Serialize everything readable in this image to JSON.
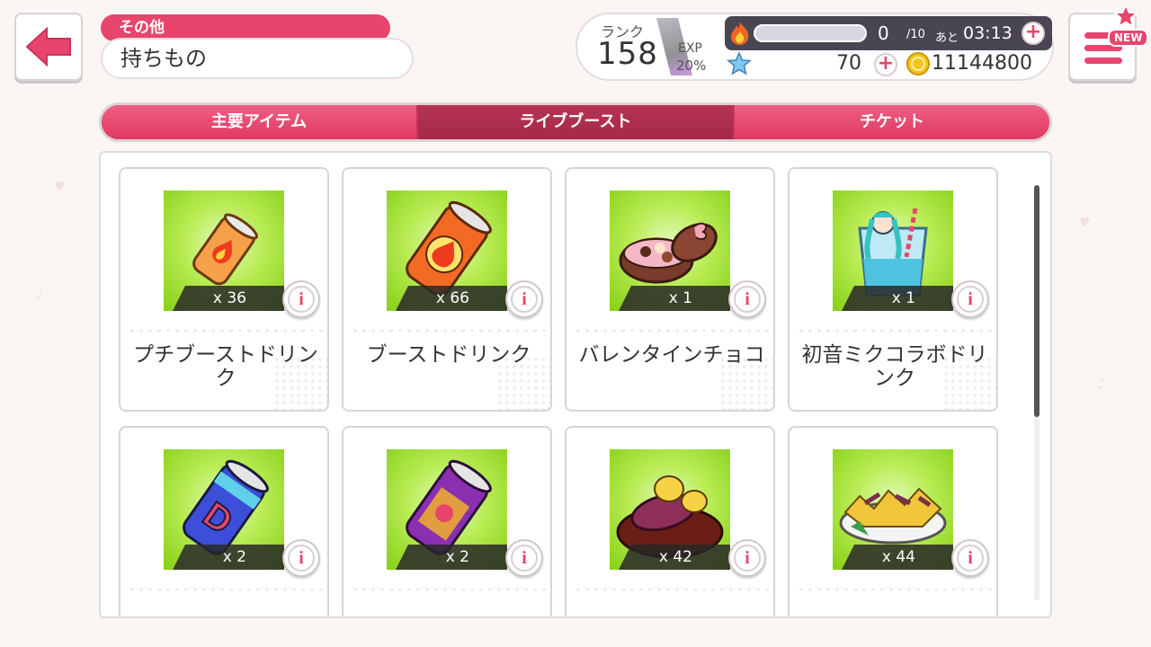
{
  "header": {
    "breadcrumb": "その他",
    "title": "持ちもの"
  },
  "player": {
    "rank_label": "ランク",
    "rank": "158",
    "exp_label": "EXP",
    "exp_percent": "20%",
    "stamina": "0",
    "stamina_max": "/10",
    "stamina_timer_label": "あと",
    "stamina_timer": "03:13",
    "stones": "70",
    "coins": "11144800"
  },
  "menu": {
    "new_badge": "NEW"
  },
  "tabs": [
    {
      "label": "主要アイテム",
      "active": false
    },
    {
      "label": "ライブブースト",
      "active": true
    },
    {
      "label": "チケット",
      "active": false
    }
  ],
  "items": [
    {
      "name": "プチブーストドリンク",
      "qty": "x 36",
      "icon": "small-boost-drink-can-icon"
    },
    {
      "name": "ブーストドリンク",
      "qty": "x 66",
      "icon": "boost-drink-can-icon"
    },
    {
      "name": "バレンタインチョコ",
      "qty": "x 1",
      "icon": "valentine-chocolate-box-icon"
    },
    {
      "name": "初音ミクコラボドリンク",
      "qty": "x 1",
      "icon": "miku-collab-drink-icon"
    },
    {
      "name": "",
      "qty": "x 2",
      "icon": "d-can-drink-icon"
    },
    {
      "name": "",
      "qty": "x 2",
      "icon": "purple-can-drink-icon"
    },
    {
      "name": "",
      "qty": "x 42",
      "icon": "sweet-potato-icon"
    },
    {
      "name": "",
      "qty": "x 44",
      "icon": "fries-plate-icon"
    }
  ],
  "colors": {
    "accent": "#e8456c",
    "tab_active": "#a72848",
    "thumb_green": "#9fdc2e"
  }
}
